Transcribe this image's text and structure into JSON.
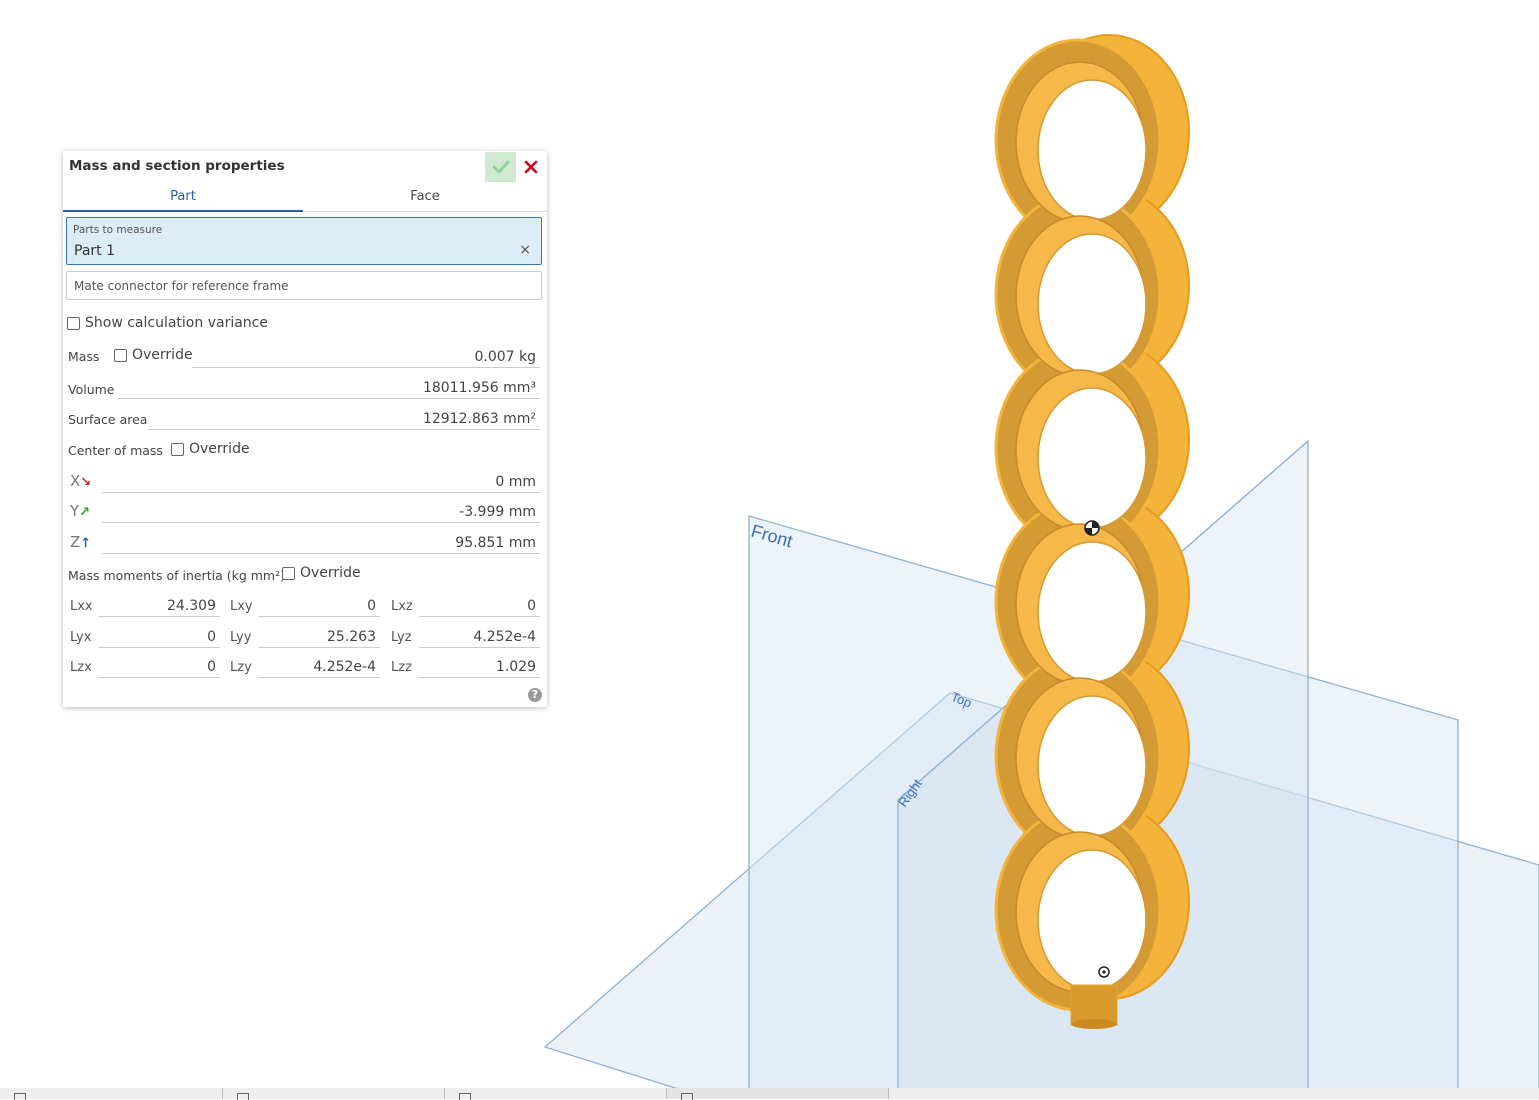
{
  "panel": {
    "title": "Mass and section properties",
    "tabs": [
      "Part",
      "Face"
    ],
    "parts_label": "Parts to measure",
    "parts_value": "Part 1",
    "mate_placeholder": "Mate connector for reference frame",
    "show_variance": "Show calculation variance",
    "mass_label": "Mass",
    "override": "Override",
    "mass_value": "0.007 kg",
    "volume_label": "Volume",
    "volume_value": "18011.956 mm³",
    "surface_label": "Surface area",
    "surface_value": "12912.863 mm²",
    "com_label": "Center of mass",
    "com": {
      "x_label": "X",
      "x_value": "0 mm",
      "y_label": "Y",
      "y_value": "-3.999 mm",
      "z_label": "Z",
      "z_value": "95.851 mm"
    },
    "inertia_label": "Mass moments of inertia (kg mm²)",
    "inertia": [
      [
        {
          "label": "Lxx",
          "value": "24.309"
        },
        {
          "label": "Lxy",
          "value": "0"
        },
        {
          "label": "Lxz",
          "value": "0"
        }
      ],
      [
        {
          "label": "Lyx",
          "value": "0"
        },
        {
          "label": "Lyy",
          "value": "25.263"
        },
        {
          "label": "Lyz",
          "value": "4.252e-4"
        }
      ],
      [
        {
          "label": "Lzx",
          "value": "0"
        },
        {
          "label": "Lzy",
          "value": "4.252e-4"
        },
        {
          "label": "Lzz",
          "value": "1.029"
        }
      ]
    ],
    "help_glyph": "?"
  },
  "viewport": {
    "plane_labels": {
      "front": "Front",
      "top": "Top",
      "right": "Right"
    },
    "part_color": "#f4b43c",
    "plane_color": "#d6e7f3"
  },
  "icons": {
    "confirm": "check-icon",
    "cancel": "close-icon",
    "clear": "clear-icon",
    "help": "help-icon",
    "center_of_mass": "center-of-mass-icon",
    "origin": "origin-icon"
  },
  "colors": {
    "accent": "#2a5caa",
    "confirm_bg": "#cfe9d3",
    "confirm_check": "#8fd29a",
    "cancel": "#d0021b",
    "x_axis": "#cc2222",
    "y_axis": "#22aa22",
    "z_axis": "#1f5fbf"
  }
}
